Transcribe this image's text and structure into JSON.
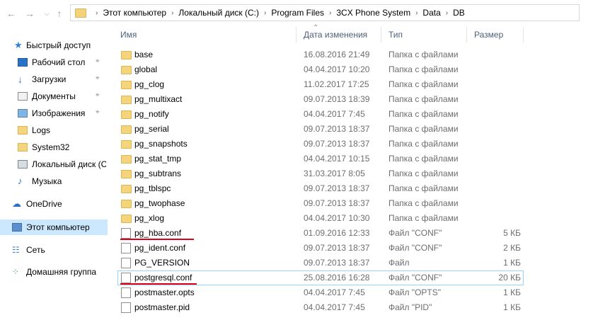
{
  "breadcrumbs": [
    "Этот компьютер",
    "Локальный диск (C:)",
    "Program Files",
    "3CX Phone System",
    "Data",
    "DB"
  ],
  "columns": {
    "name": "Имя",
    "date": "Дата изменения",
    "type": "Тип",
    "size": "Размер"
  },
  "sidebar": [
    {
      "label": "Быстрый доступ",
      "icon": "star-icon",
      "pinned": false
    },
    {
      "label": "Рабочий стол",
      "icon": "desktop-icon",
      "pinned": true
    },
    {
      "label": "Загрузки",
      "icon": "download-icon",
      "pinned": true
    },
    {
      "label": "Документы",
      "icon": "documents-icon",
      "pinned": true
    },
    {
      "label": "Изображения",
      "icon": "pictures-icon",
      "pinned": true
    },
    {
      "label": "Logs",
      "icon": "folder-icon",
      "pinned": false
    },
    {
      "label": "System32",
      "icon": "folder-icon",
      "pinned": false
    },
    {
      "label": "Локальный диск (C",
      "icon": "drive-icon",
      "pinned": false
    },
    {
      "label": "Музыка",
      "icon": "music-icon",
      "pinned": false
    },
    {
      "label": "OneDrive",
      "icon": "cloud-icon",
      "pinned": false
    },
    {
      "label": "Этот компьютер",
      "icon": "computer-icon",
      "pinned": false,
      "selected": true
    },
    {
      "label": "Сеть",
      "icon": "network-icon",
      "pinned": false
    },
    {
      "label": "Домашняя группа",
      "icon": "homegroup-icon",
      "pinned": false
    }
  ],
  "files": [
    {
      "name": "base",
      "date": "16.08.2016 21:49",
      "type": "Папка с файлами",
      "size": "",
      "kind": "folder"
    },
    {
      "name": "global",
      "date": "04.04.2017 10:20",
      "type": "Папка с файлами",
      "size": "",
      "kind": "folder"
    },
    {
      "name": "pg_clog",
      "date": "11.02.2017 17:25",
      "type": "Папка с файлами",
      "size": "",
      "kind": "folder"
    },
    {
      "name": "pg_multixact",
      "date": "09.07.2013 18:39",
      "type": "Папка с файлами",
      "size": "",
      "kind": "folder"
    },
    {
      "name": "pg_notify",
      "date": "04.04.2017 7:45",
      "type": "Папка с файлами",
      "size": "",
      "kind": "folder"
    },
    {
      "name": "pg_serial",
      "date": "09.07.2013 18:37",
      "type": "Папка с файлами",
      "size": "",
      "kind": "folder"
    },
    {
      "name": "pg_snapshots",
      "date": "09.07.2013 18:37",
      "type": "Папка с файлами",
      "size": "",
      "kind": "folder"
    },
    {
      "name": "pg_stat_tmp",
      "date": "04.04.2017 10:15",
      "type": "Папка с файлами",
      "size": "",
      "kind": "folder"
    },
    {
      "name": "pg_subtrans",
      "date": "31.03.2017 8:05",
      "type": "Папка с файлами",
      "size": "",
      "kind": "folder"
    },
    {
      "name": "pg_tblspc",
      "date": "09.07.2013 18:37",
      "type": "Папка с файлами",
      "size": "",
      "kind": "folder"
    },
    {
      "name": "pg_twophase",
      "date": "09.07.2013 18:37",
      "type": "Папка с файлами",
      "size": "",
      "kind": "folder"
    },
    {
      "name": "pg_xlog",
      "date": "04.04.2017 10:30",
      "type": "Папка с файлами",
      "size": "",
      "kind": "folder"
    },
    {
      "name": "pg_hba.conf",
      "date": "01.09.2016 12:33",
      "type": "Файл \"CONF\"",
      "size": "5 КБ",
      "kind": "file",
      "underlined": true
    },
    {
      "name": "pg_ident.conf",
      "date": "09.07.2013 18:37",
      "type": "Файл \"CONF\"",
      "size": "2 КБ",
      "kind": "file"
    },
    {
      "name": "PG_VERSION",
      "date": "09.07.2013 18:37",
      "type": "Файл",
      "size": "1 КБ",
      "kind": "file"
    },
    {
      "name": "postgresql.conf",
      "date": "25.08.2016 16:28",
      "type": "Файл \"CONF\"",
      "size": "20 КБ",
      "kind": "file",
      "underlined": true,
      "focused": true
    },
    {
      "name": "postmaster.opts",
      "date": "04.04.2017 7:45",
      "type": "Файл \"OPTS\"",
      "size": "1 КБ",
      "kind": "file"
    },
    {
      "name": "postmaster.pid",
      "date": "04.04.2017 7:45",
      "type": "Файл \"PID\"",
      "size": "1 КБ",
      "kind": "file"
    }
  ],
  "colors": {
    "selection": "#cce8ff",
    "focus_border": "#99d1ff",
    "annotation": "#e0001a",
    "header_text": "#4c607a"
  }
}
